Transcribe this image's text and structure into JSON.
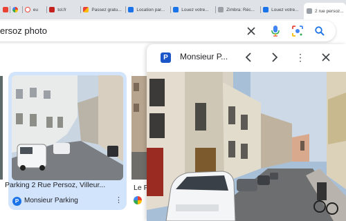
{
  "tabs": [
    {
      "label": "",
      "favicon_color": "#ea4335"
    },
    {
      "label": "",
      "favicon_color": "#4285f4"
    },
    {
      "label": "eu",
      "favicon_color": "#ea4335"
    },
    {
      "label": "tol.fr",
      "favicon_color": "#ffffff"
    },
    {
      "label": "Passez gratu...",
      "favicon_color": "#c5221f"
    },
    {
      "label": "Location par...",
      "favicon_color": "#1a73e8"
    },
    {
      "label": "Louez votre...",
      "favicon_color": "#1a73e8"
    },
    {
      "label": "Zimbra: Réc...",
      "favicon_color": "#9aa0a6"
    },
    {
      "label": "Louez votre...",
      "favicon_color": "#1a73e8"
    },
    {
      "label": "2 rue persoz...",
      "favicon_color": "#9aa0a6",
      "active": true
    }
  ],
  "search": {
    "query": "ersoz photo"
  },
  "result_card": {
    "title": "Parking 2 Rue Persoz, Villeur...",
    "source": "Monsieur Parking",
    "logo_letter": "P"
  },
  "second_card": {
    "title": "Le P"
  },
  "panel": {
    "site_name": "Monsieur P...",
    "logo_letter": "P"
  },
  "colors": {
    "accent": "#1a73e8",
    "selected_card_bg": "#d2e3fc"
  }
}
